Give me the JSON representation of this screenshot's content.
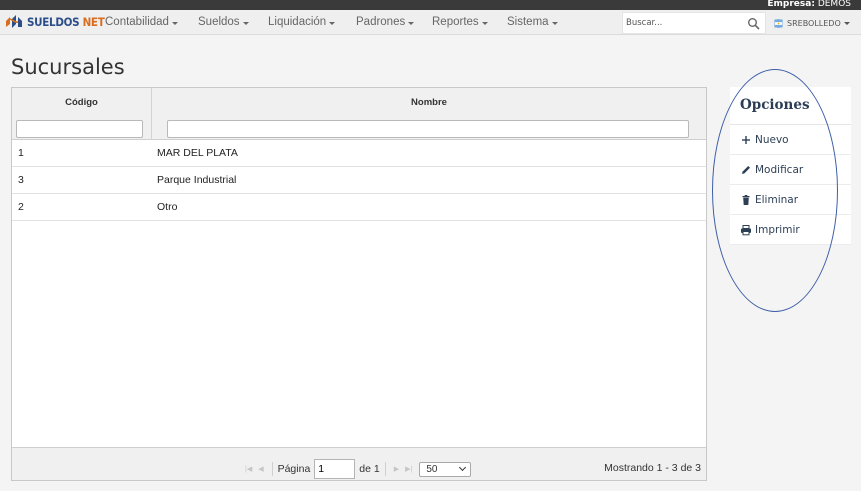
{
  "company": {
    "label": "Empresa:",
    "name": "DEMOS"
  },
  "brand": {
    "part1": "SUELDOS",
    "part2": "NET"
  },
  "menu": [
    {
      "label": "Contabilidad",
      "key": "contabilidad"
    },
    {
      "label": "Sueldos",
      "key": "sueldos"
    },
    {
      "label": "Liquidación",
      "key": "liquidacion"
    },
    {
      "label": "Padrones",
      "key": "padrones"
    },
    {
      "label": "Reportes",
      "key": "reportes"
    },
    {
      "label": "Sistema",
      "key": "sistema"
    }
  ],
  "search": {
    "placeholder": "Buscar...",
    "value": ""
  },
  "user": {
    "name": "SREBOLLEDO"
  },
  "page": {
    "title": "Sucursales"
  },
  "grid": {
    "columns": [
      "Código",
      "Nombre"
    ],
    "rows": [
      {
        "codigo": "1",
        "nombre": "MAR DEL PLATA"
      },
      {
        "codigo": "3",
        "nombre": "Parque Industrial"
      },
      {
        "codigo": "2",
        "nombre": "Otro"
      }
    ],
    "pager": {
      "page_label": "Página",
      "page_value": "1",
      "of_label": "de 1",
      "page_size": "50",
      "showing": "Mostrando 1 - 3 de 3"
    }
  },
  "options": {
    "title": "Opciones",
    "items": [
      {
        "label": "Nuevo",
        "icon": "plus-icon"
      },
      {
        "label": "Modificar",
        "icon": "pencil-icon"
      },
      {
        "label": "Eliminar",
        "icon": "trash-icon"
      },
      {
        "label": "Imprimir",
        "icon": "printer-icon"
      }
    ]
  },
  "colors": {
    "brand_blue": "#2c4f8a",
    "brand_orange": "#d86d1e",
    "annotation_ellipse": "#3e5fa8"
  }
}
